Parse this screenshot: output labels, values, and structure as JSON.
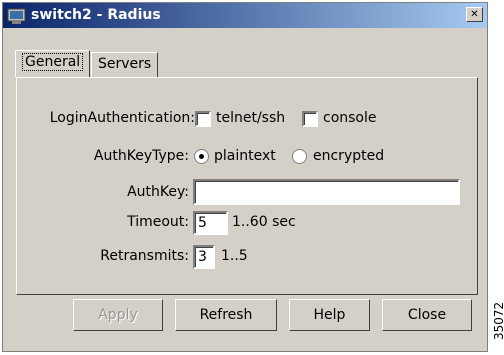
{
  "window": {
    "title": "switch2 - Radius",
    "close_glyph": "✕"
  },
  "tabs": [
    {
      "label": "General",
      "active": true
    },
    {
      "label": "Servers",
      "active": false
    }
  ],
  "form": {
    "login_auth": {
      "label": "LoginAuthentication:",
      "options": [
        {
          "label": "telnet/ssh",
          "checked": false
        },
        {
          "label": "console",
          "checked": false
        }
      ]
    },
    "auth_key_type": {
      "label": "AuthKeyType:",
      "options": [
        {
          "label": "plaintext",
          "selected": true
        },
        {
          "label": "encrypted",
          "selected": false
        }
      ]
    },
    "auth_key": {
      "label": "AuthKey:",
      "value": ""
    },
    "timeout": {
      "label": "Timeout:",
      "value": "5",
      "hint": "1..60 sec"
    },
    "retransmits": {
      "label": "Retransmits:",
      "value": "3",
      "hint": "1..5"
    }
  },
  "buttons": {
    "apply": {
      "label": "Apply",
      "enabled": false
    },
    "refresh": {
      "label": "Refresh",
      "enabled": true
    },
    "help": {
      "label": "Help",
      "enabled": true
    },
    "close": {
      "label": "Close",
      "enabled": true
    }
  },
  "figure_id": "35072"
}
